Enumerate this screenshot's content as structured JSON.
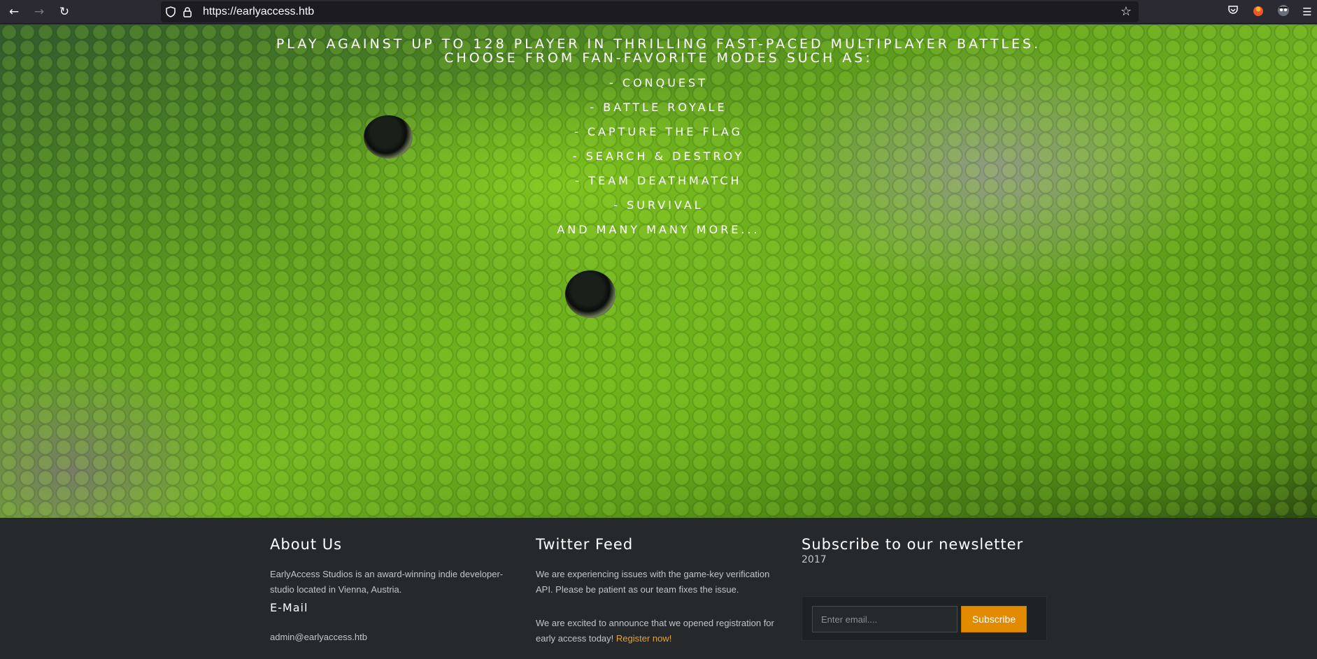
{
  "browser": {
    "url": "https://earlyaccess.htb",
    "back_glyph": "←",
    "forward_glyph": "→",
    "reload_glyph": "↻",
    "icons": [
      "shield-icon",
      "lock-icon",
      "bookmark-star-icon",
      "pocket-icon",
      "extension-icon",
      "profile-icon",
      "menu-icon"
    ]
  },
  "hero": {
    "intro_line1": "PLAY AGAINST UP TO 128 PLAYER IN THRILLING FAST-PACED MULTIPLAYER BATTLES.",
    "intro_line2": "CHOOSE FROM FAN-FAVORITE MODES SUCH AS:",
    "modes": [
      "- CONQUEST",
      "- BATTLE ROYALE",
      "- CAPTURE THE FLAG",
      "- SEARCH & DESTROY",
      "- TEAM DEATHMATCH",
      "- SURVIVAL"
    ],
    "outro": "AND MANY MANY MORE..."
  },
  "footer": {
    "about": {
      "title": "About Us",
      "text": "EarlyAccess Studios is an award-winning indie developer-studio located in Vienna, Austria.",
      "email_heading": "E-Mail",
      "email": "admin@earlyaccess.htb"
    },
    "twitter": {
      "title": "Twitter Feed",
      "tweet1": "We are experiencing issues with the game-key verification API. Please be patient as our team fixes the issue.",
      "tweet2": "We are excited to announce that we opened registration for early access today!",
      "tweet2_link": "Register now!"
    },
    "newsletter": {
      "title": "Subscribe to our newsletter",
      "year": "2017",
      "email_placeholder": "Enter email....",
      "button_label": "Subscribe"
    }
  },
  "colors": {
    "accent": "#e38b00",
    "link": "#f0a020",
    "footer_bg": "#25292c"
  }
}
